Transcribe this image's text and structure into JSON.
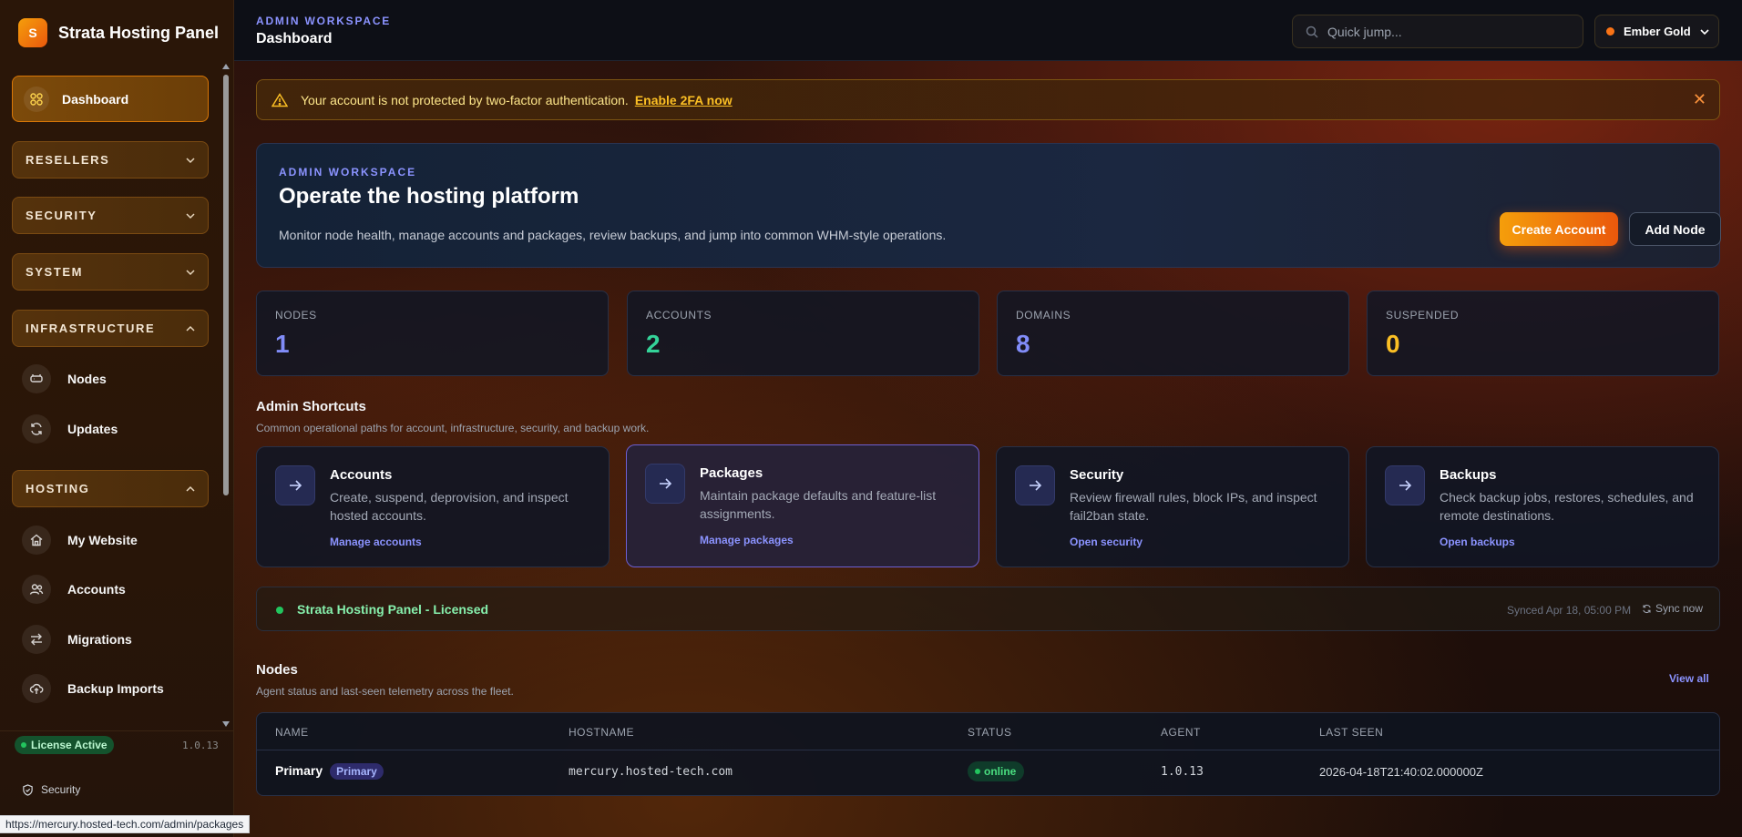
{
  "app": {
    "logo_letter": "S",
    "name": "Strata Hosting Panel"
  },
  "sidebar": {
    "active": {
      "label": "Dashboard",
      "icon": "grid-icon"
    },
    "sections": [
      {
        "label": "RESELLERS",
        "expanded": false
      },
      {
        "label": "SECURITY",
        "expanded": false
      },
      {
        "label": "SYSTEM",
        "expanded": false
      },
      {
        "label": "INFRASTRUCTURE",
        "expanded": true
      },
      {
        "label": "HOSTING",
        "expanded": true
      }
    ],
    "infrastructure_items": [
      {
        "label": "Nodes",
        "icon": "server-icon"
      },
      {
        "label": "Updates",
        "icon": "refresh-icon"
      }
    ],
    "hosting_items": [
      {
        "label": "My Website",
        "icon": "home-icon"
      },
      {
        "label": "Accounts",
        "icon": "users-icon"
      },
      {
        "label": "Migrations",
        "icon": "swap-icon"
      },
      {
        "label": "Backup Imports",
        "icon": "upload-cloud-icon"
      }
    ],
    "footer": {
      "license": "License Active",
      "version": "1.0.13",
      "link": "Security"
    }
  },
  "topbar": {
    "kicker": "ADMIN WORKSPACE",
    "title": "Dashboard",
    "search_placeholder": "Quick jump...",
    "theme": "Ember Gold"
  },
  "alert": {
    "text": "Your account is not protected by two-factor authentication.",
    "link": "Enable 2FA now",
    "close": "✕"
  },
  "hero": {
    "kicker": "ADMIN WORKSPACE",
    "title": "Operate the hosting platform",
    "description": "Monitor node health, manage accounts and packages, review backups, and jump into common WHM-style operations.",
    "primary_button": "Create Account",
    "secondary_button": "Add Node"
  },
  "stats": [
    {
      "label": "NODES",
      "value": "1",
      "color": "#818cf8"
    },
    {
      "label": "ACCOUNTS",
      "value": "2",
      "color": "#34d399"
    },
    {
      "label": "DOMAINS",
      "value": "8",
      "color": "#818cf8"
    },
    {
      "label": "SUSPENDED",
      "value": "0",
      "color": "#fbbf24"
    }
  ],
  "shortcuts_section": {
    "title": "Admin Shortcuts",
    "subtitle": "Common operational paths for account, infrastructure, security, and backup work."
  },
  "shortcuts": [
    {
      "title": "Accounts",
      "description": "Create, suspend, deprovision, and inspect hosted accounts.",
      "link": "Manage accounts"
    },
    {
      "title": "Packages",
      "description": "Maintain package defaults and feature-list assignments.",
      "link": "Manage packages"
    },
    {
      "title": "Security",
      "description": "Review firewall rules, block IPs, and inspect fail2ban state.",
      "link": "Open security"
    },
    {
      "title": "Backups",
      "description": "Check backup jobs, restores, schedules, and remote destinations.",
      "link": "Open backups"
    }
  ],
  "license_bar": {
    "text": "Strata Hosting Panel - Licensed",
    "synced": "Synced Apr 18, 05:00 PM",
    "sync_button": "Sync now"
  },
  "nodes_section": {
    "title": "Nodes",
    "subtitle": "Agent status and last-seen telemetry across the fleet.",
    "view_all": "View all"
  },
  "nodes_table": {
    "columns": [
      "NAME",
      "HOSTNAME",
      "STATUS",
      "AGENT",
      "LAST SEEN"
    ],
    "rows": [
      {
        "name": "Primary",
        "badge": "Primary",
        "hostname": "mercury.hosted-tech.com",
        "status": "online",
        "agent": "1.0.13",
        "last_seen": "2026-04-18T21:40:02.000000Z"
      }
    ]
  },
  "status_url": "https://mercury.hosted-tech.com/admin/packages"
}
